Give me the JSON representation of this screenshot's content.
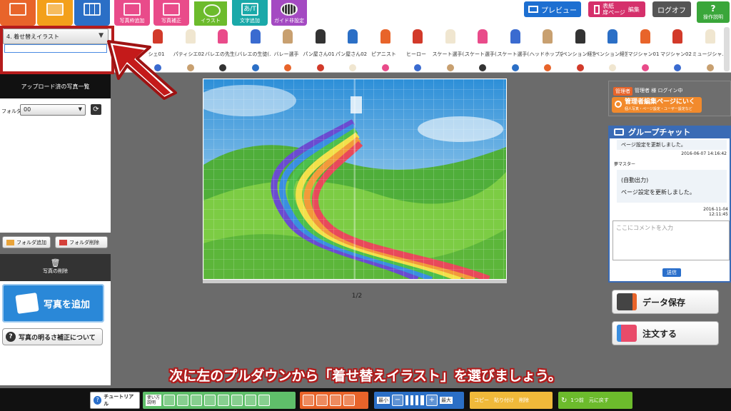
{
  "tabs": [
    {
      "label": "",
      "color": "#e8642a"
    },
    {
      "label": "",
      "color": "#f3a01b"
    },
    {
      "label": "",
      "color": "#2b6fc6"
    },
    {
      "label": "写真枠追加",
      "color": "#e94b8a"
    },
    {
      "label": "写真補正",
      "color": "#e94b8a"
    },
    {
      "label": "イラスト",
      "color": "#6cbb2c"
    },
    {
      "label": "文字追加",
      "color": "#1aa9a9"
    },
    {
      "label": "ガイド非設定",
      "color": "#a44ac2"
    }
  ],
  "text_tab_glyph": "あ/T",
  "top_buttons": {
    "preview": "プレビュー",
    "cover": "表紙\n扉ページ",
    "edit": "編集",
    "logout": "ログオフ",
    "help": "操作説明",
    "help_glyph": "?"
  },
  "category": {
    "selected": "4. 着せ替えイラスト",
    "arrow": "▼"
  },
  "illustrations": [
    "シェ01",
    "パティシエ02",
    "バレエの先生(…",
    "バレエの生徒(…",
    "バレー選手",
    "パン屋さん01",
    "パン屋さん02",
    "ピアニスト",
    "ヒーロー",
    "スケート選手(…",
    "スケート選手(…",
    "スケート選手(…",
    "ヘッドホップ店員",
    "ペンション経営…",
    "ペンション経営…",
    "マジシャン01",
    "マジシャン02",
    "ミュージシャ…"
  ],
  "sidebar": {
    "header": "アップロード済の写真一覧",
    "folder_label": "フォルダ：",
    "folder_value": "00",
    "refresh_glyph": "⟳",
    "add_folder": "フォルダ追加",
    "del_folder": "フォルダ削除",
    "delete_photo": "写真の削除",
    "add_photo": "写真を追加",
    "brightness": "写真の明るさ補正について",
    "brightness_icon": "?",
    "trash_icon": "🗑"
  },
  "page_indicator": "1/2",
  "right": {
    "admin_badge": "管理者",
    "login_status": "管理者 様 ログイン中",
    "admin_link": "管理者編集ページにいく",
    "admin_sub": "個人写真・ページ設定・ユーザー設定など",
    "chat_title": "グループチャット",
    "msg1": "ページ設定を更新しました。",
    "time1": "2016-06-07 14:16:42",
    "sender": "夢マスター",
    "msg2_line1": "(自動出力)",
    "msg2_line2": "ページ設定を更新しました。",
    "time2": "2016-11-04 12:11:45",
    "comment_placeholder": "ここにコメントを入力",
    "send": "送信",
    "save": "データ保存",
    "order": "注文する"
  },
  "caption": "次に左のプルダウンから「着せ替えイラスト」を選びましょう。",
  "bottom": {
    "tutorial": "チュートリアル",
    "howto": "使い方\n説明",
    "zoom_min": "最小",
    "zoom_max": "最大",
    "zoom_plus": "+",
    "zoom_minus": "−",
    "copy": "コピー",
    "paste": "貼り付け",
    "delete": "削除",
    "undo": "1つ前",
    "redo": "元に戻す",
    "undo_glyph": "↻"
  },
  "colors": {
    "accent_red": "#b51c1c",
    "green_group": "#5fbf6a",
    "orange_group": "#e8642a",
    "blue_group": "#2b6fc6",
    "yellow_group": "#f0b93a",
    "lime_group": "#6cbb2c"
  }
}
